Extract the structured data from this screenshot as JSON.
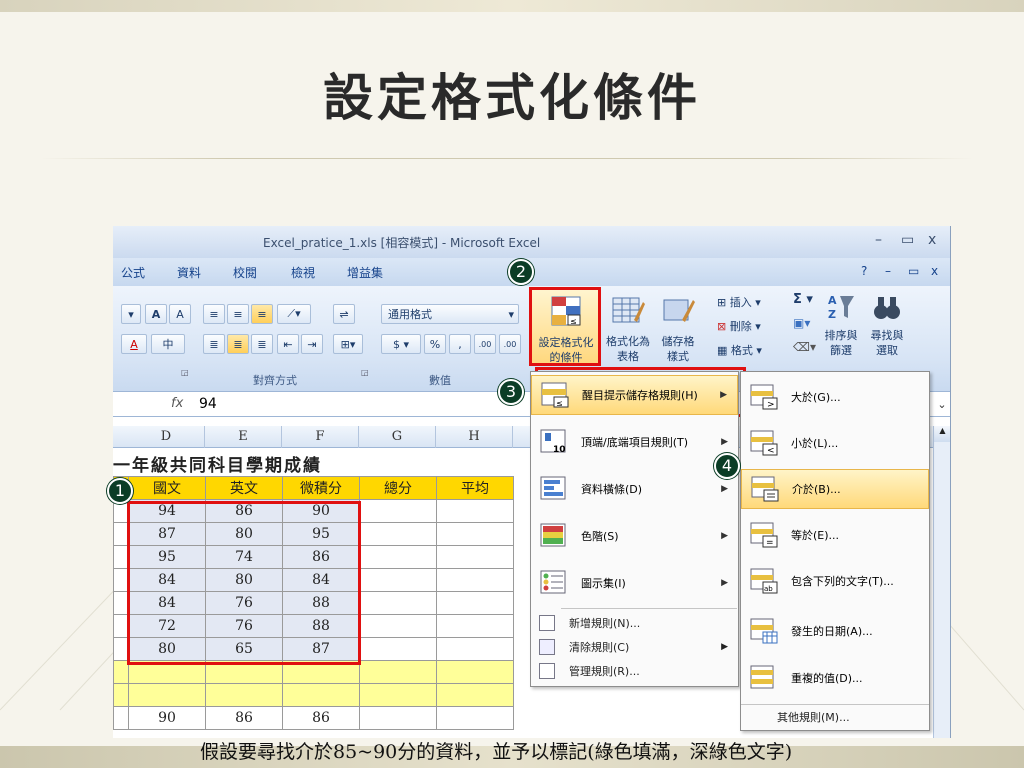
{
  "slide": {
    "title": "設定格式化條件",
    "caption": "假設要尋找介於85~90分的資料，並予以標記(綠色填滿，深綠色文字)"
  },
  "window": {
    "title": "Excel_pratice_1.xls  [相容模式] - Microsoft Excel",
    "minimize": "–",
    "maximize": "▭",
    "close": "x"
  },
  "tabs": [
    "公式",
    "資料",
    "校閱",
    "檢視",
    "增益集"
  ],
  "ribbon": {
    "font_grow": "A",
    "font_shrink": "A",
    "font_color": "A",
    "phonetic": "中",
    "number_format": "通用格式",
    "currency": "$",
    "percent": "%",
    "comma": ",",
    "inc_decimal": ".00",
    "dec_decimal": ".00",
    "align_group": "對齊方式",
    "number_group": "數值",
    "conditional_formatting": [
      "設定格式化",
      "的條件"
    ],
    "format_as_table": [
      "格式化為",
      "表格"
    ],
    "cell_styles": [
      "儲存格",
      "樣式"
    ],
    "insert": "插入",
    "delete": "刪除",
    "format": "格式",
    "sort_filter": [
      "排序與",
      "篩選"
    ],
    "find_select": [
      "尋找與",
      "選取"
    ],
    "sigma": "Σ"
  },
  "formula_bar": {
    "fx": "fx",
    "value": "94"
  },
  "columns": [
    "D",
    "E",
    "F",
    "G",
    "H"
  ],
  "sheet": {
    "title": "一年級共同科目學期成績",
    "headers": [
      "國文",
      "英文",
      "微積分",
      "總分",
      "平均"
    ],
    "rows": [
      [
        "94",
        "86",
        "90"
      ],
      [
        "87",
        "80",
        "95"
      ],
      [
        "95",
        "74",
        "86"
      ],
      [
        "84",
        "80",
        "84"
      ],
      [
        "84",
        "76",
        "88"
      ],
      [
        "72",
        "76",
        "88"
      ],
      [
        "80",
        "65",
        "87"
      ]
    ],
    "last_row": [
      "90",
      "86",
      "86"
    ]
  },
  "menu1": {
    "items": [
      "醒目提示儲存格規則(H)",
      "頂端/底端項目規則(T)",
      "資料橫條(D)",
      "色階(S)",
      "圖示集(I)"
    ],
    "small_items": [
      "新增規則(N)...",
      "清除規則(C)",
      "管理規則(R)..."
    ]
  },
  "menu2": {
    "items": [
      "大於(G)...",
      "小於(L)...",
      "介於(B)...",
      "等於(E)...",
      "包含下列的文字(T)...",
      "發生的日期(A)...",
      "重複的值(D)..."
    ],
    "more": "其他規則(M)..."
  },
  "badges": [
    "1",
    "2",
    "3",
    "4"
  ],
  "colors": {
    "highlight_red": "#e01010",
    "header_gold": "#ffd700",
    "empty_yellow": "#ffff99",
    "badge_green": "#0b3d26"
  }
}
